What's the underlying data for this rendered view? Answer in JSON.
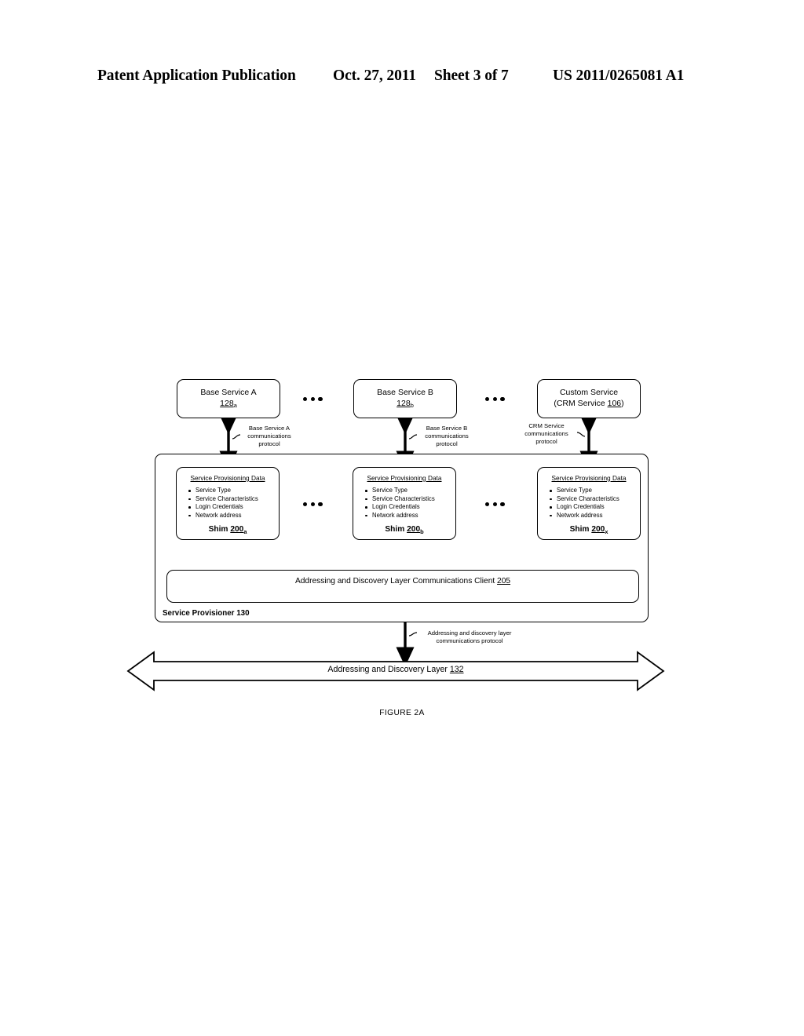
{
  "header": {
    "title": "Patent Application Publication",
    "date": "Oct. 27, 2011",
    "sheet": "Sheet 3 of 7",
    "number": "US 2011/0265081 A1"
  },
  "figure": {
    "caption": "FIGURE 2A",
    "services": [
      {
        "name": "svc-a",
        "line1": "Base Service A",
        "ref": "128",
        "sub": "a",
        "line2": ""
      },
      {
        "name": "svc-b",
        "line1": "Base Service B",
        "ref": "128",
        "sub": "b",
        "line2": ""
      },
      {
        "name": "svc-c",
        "line1": "Custom Service",
        "line2_prefix": "(CRM Service ",
        "ref": "106",
        "line2_suffix": ")"
      }
    ],
    "shims": [
      {
        "title": "Service Provisioning Data",
        "items": [
          "Service Type",
          "Service Characteristics",
          "Login Credentials",
          "Network address"
        ],
        "label": "Shim ",
        "ref": "200",
        "sub": "a"
      },
      {
        "title": "Service Provisioning Data",
        "items": [
          "Service Type",
          "Service Characteristics",
          "Login Credentials",
          "Network address"
        ],
        "label": "Shim ",
        "ref": "200",
        "sub": "b"
      },
      {
        "title": "Service Provisioning Data",
        "items": [
          "Service Type",
          "Service Characteristics",
          "Login Credentials",
          "Network address"
        ],
        "label": "Shim ",
        "ref": "200",
        "sub": "x"
      }
    ],
    "provisioner": {
      "label": "Service Provisioner 130"
    },
    "adl_client": {
      "line1": "Addressing and Discovery Layer Communications Client",
      "ref": "205"
    },
    "protocols": [
      {
        "name": "proto-a",
        "text": "Base Service A\ncommunications\nprotocol"
      },
      {
        "name": "proto-b",
        "text": "Base Service B\ncommunications\nprotocol"
      },
      {
        "name": "proto-c",
        "text": "CRM Service\ncommunications\nprotocol"
      },
      {
        "name": "proto-adl",
        "text": "Addressing and discovery layer\ncommunications protocol"
      }
    ],
    "banner": {
      "text": "Addressing and Discovery Layer ",
      "ref": "132"
    },
    "colors": {
      "line": "#000000",
      "background": "#ffffff"
    }
  }
}
